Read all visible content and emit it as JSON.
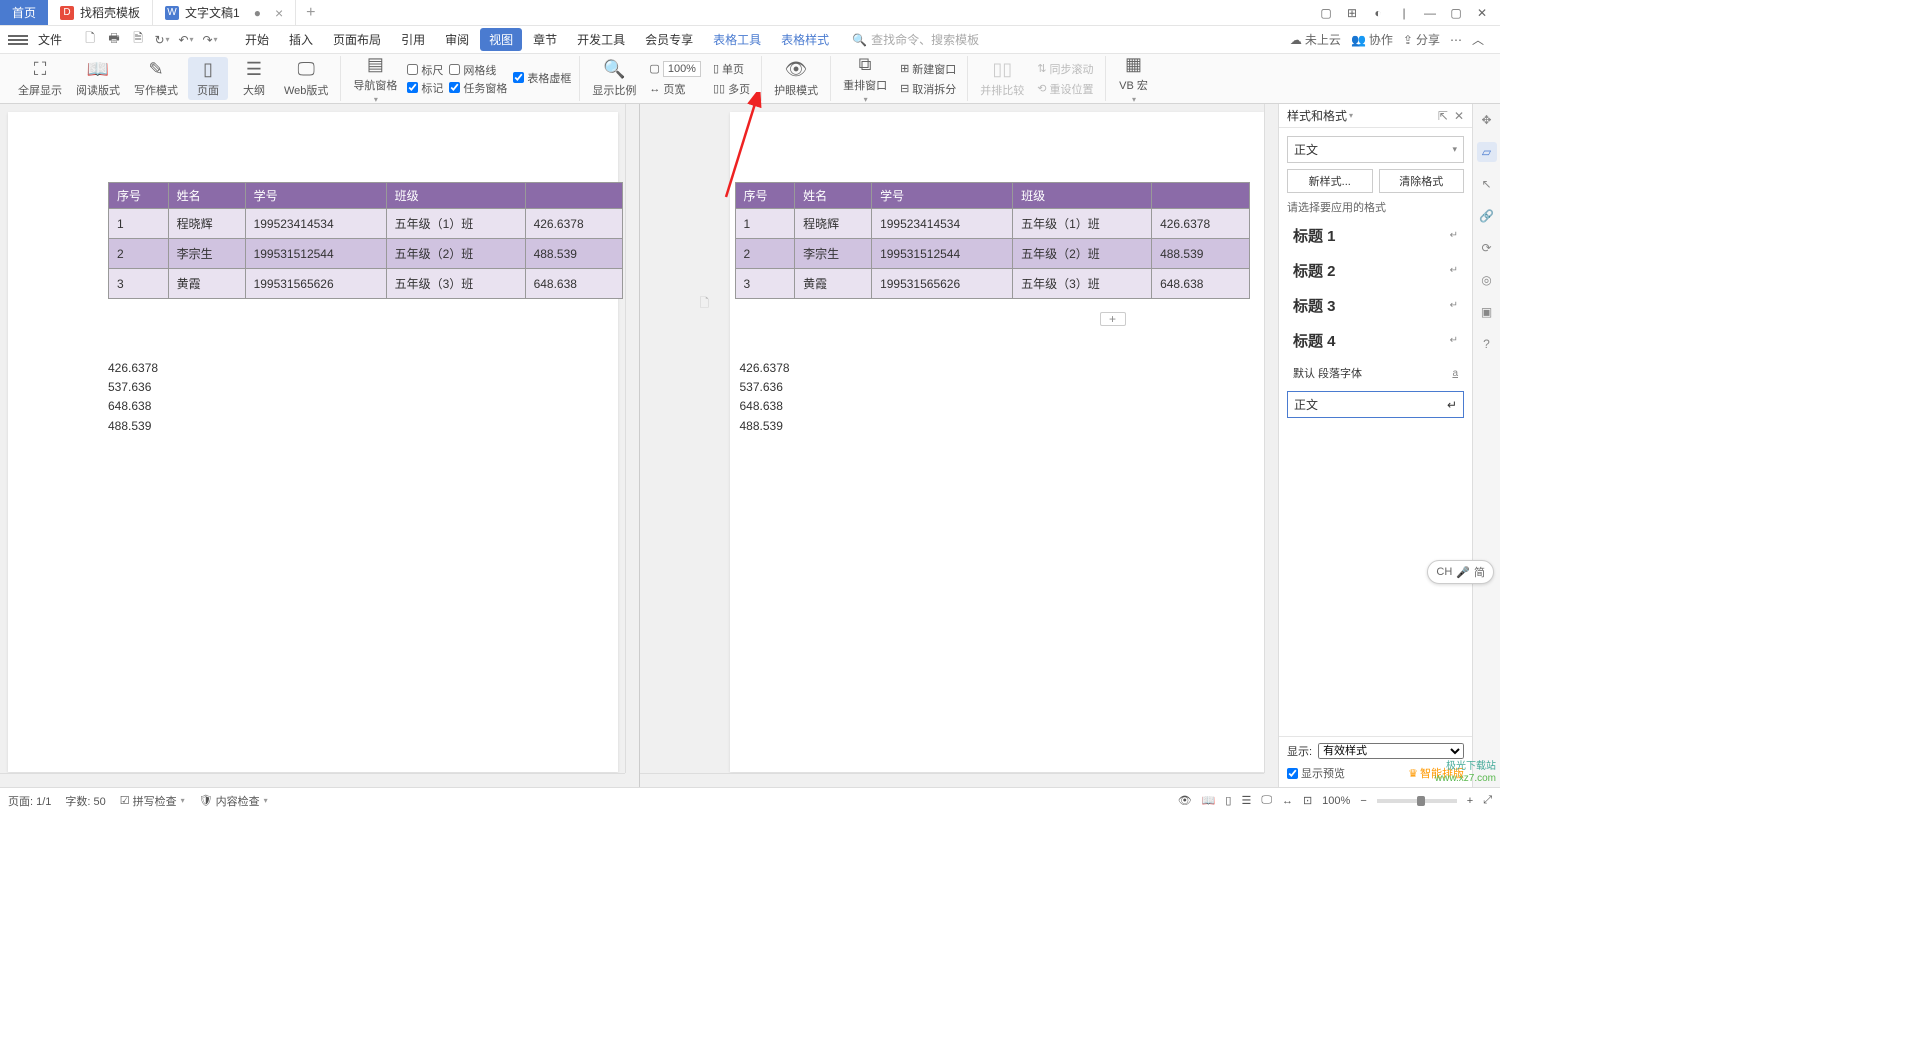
{
  "titlebar": {
    "home_tab": "首页",
    "template_tab": "找稻壳模板",
    "doc_tab": "文字文稿1",
    "dirty_marker": "●",
    "close_glyph": "×",
    "add_glyph": "+"
  },
  "menurow": {
    "file": "文件",
    "menus": [
      "开始",
      "插入",
      "页面布局",
      "引用",
      "审阅",
      "视图",
      "章节",
      "开发工具",
      "会员专享",
      "表格工具",
      "表格样式"
    ],
    "active_index": 5,
    "blue_indexes": [
      9,
      10
    ],
    "search_placeholder": "查找命令、搜索模板",
    "right": {
      "cloud": "未上云",
      "collab": "协作",
      "share": "分享"
    }
  },
  "ribbon": {
    "fullscreen": "全屏显示",
    "read_layout": "阅读版式",
    "write_mode": "写作模式",
    "page": "页面",
    "outline": "大纲",
    "web_layout": "Web版式",
    "nav_pane": "导航窗格",
    "chk_ruler": "标尺",
    "chk_grid": "网格线",
    "chk_mark": "标记",
    "chk_table_dashed": "表格虚框",
    "chk_task_pane": "任务窗格",
    "zoom_ratio": "显示比例",
    "zoom_value": "100%",
    "single_page": "单页",
    "page_width": "页宽",
    "multi_page": "多页",
    "eye_protect": "护眼模式",
    "arrange_window": "重排窗口",
    "new_window": "新建窗口",
    "cancel_split": "取消拆分",
    "side_by_side": "并排比较",
    "sync_scroll": "同步滚动",
    "reset_pos": "重设位置",
    "vb_macro": "VB 宏"
  },
  "table": {
    "headers": [
      "序号",
      "姓名",
      "学号",
      "班级",
      ""
    ],
    "rows": [
      [
        "1",
        "程晓辉",
        "199523414534",
        "五年级（1）班",
        "426.6378"
      ],
      [
        "2",
        "李宗生",
        "199531512544",
        "五年级（2）班",
        "488.539"
      ],
      [
        "3",
        "黄霞",
        "199531565626",
        "五年级（3）班",
        "648.638"
      ]
    ]
  },
  "paragraphs": [
    "426.6378",
    "537.636",
    "648.638",
    "488.539"
  ],
  "panel": {
    "title": "样式和格式",
    "current_style": "正文",
    "new_style_btn": "新样式...",
    "clear_format_btn": "清除格式",
    "hint": "请选择要应用的格式",
    "heading_items": [
      "标题 1",
      "标题 2",
      "标题 3",
      "标题 4"
    ],
    "default_font_label": "默认 段落字体",
    "body_text": "正文",
    "display_label": "显示:",
    "display_value": "有效样式",
    "preview_chk": "显示预览",
    "smart_layout": "智能排版"
  },
  "statusbar": {
    "page_info": "页面: 1/1",
    "word_count": "字数: 50",
    "spell_check": "拼写检查",
    "content_check": "内容检查",
    "zoom": "100%"
  },
  "ime": {
    "lang": "CH",
    "mode": "简"
  },
  "watermark": {
    "line1": "极光下载站",
    "line2": "www.xz7.com"
  },
  "add_btn": "+"
}
